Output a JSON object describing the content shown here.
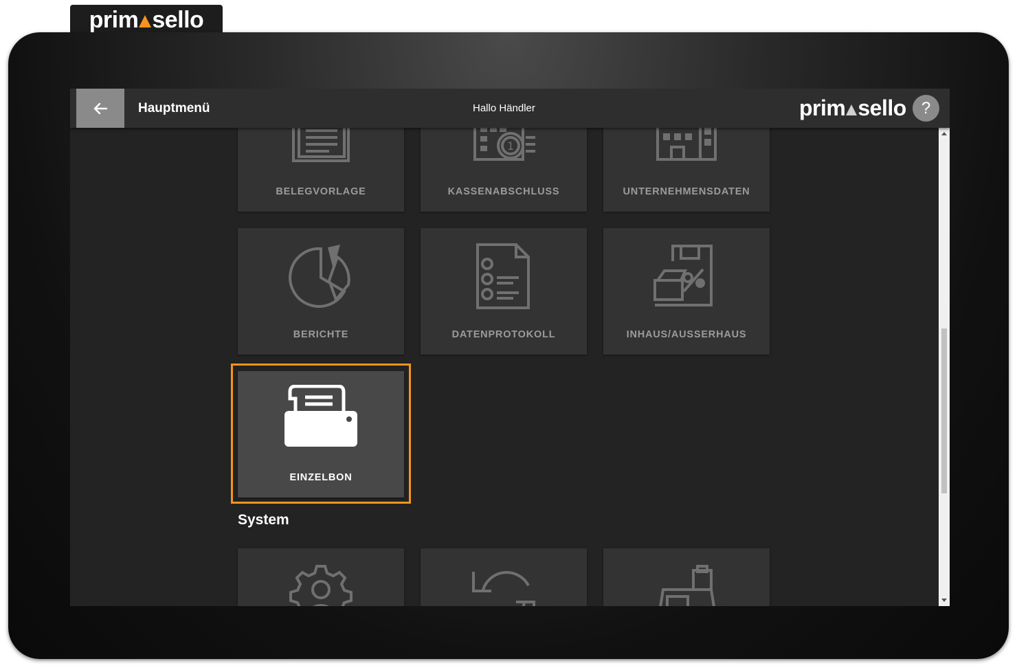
{
  "brand": {
    "left": "prim",
    "right": "sello"
  },
  "header": {
    "title": "Hauptmenü",
    "greeting": "Hallo Händler",
    "help_label": "?"
  },
  "tiles": [
    {
      "label": "BELEGVORLAGE",
      "icon": "document-lines-icon"
    },
    {
      "label": "KASSENABSCHLUSS",
      "icon": "cash-register-coin-icon"
    },
    {
      "label": "UNTERNEHMENSDATEN",
      "icon": "building-icon"
    },
    {
      "label": "BERICHTE",
      "icon": "pie-chart-icon"
    },
    {
      "label": "DATENPROTOKOLL",
      "icon": "checklist-document-icon"
    },
    {
      "label": "INHAUS/AUSSERHAUS",
      "icon": "takeaway-icon"
    },
    {
      "label": "EINZELBON",
      "icon": "printer-icon",
      "selected": true
    }
  ],
  "section": {
    "title": "System"
  },
  "system_tiles": [
    {
      "icon": "user-settings-icon"
    },
    {
      "icon": "refresh-icon"
    },
    {
      "icon": "cash-register-icon"
    }
  ],
  "colors": {
    "accent": "#f7941d",
    "tile": "#333333",
    "tile_active": "#484848",
    "background": "#232323"
  }
}
